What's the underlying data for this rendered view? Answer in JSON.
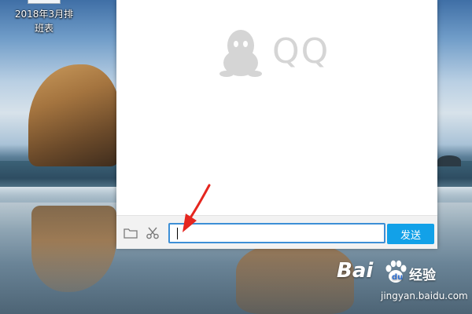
{
  "desktop": {
    "file_icon_label": "2018年3月排班表"
  },
  "qq_window": {
    "logo_text": "QQ",
    "toolbar": {
      "folder_icon": "folder-icon",
      "scissors_icon": "scissors-icon",
      "message_input_value": "",
      "send_label": "发送"
    }
  },
  "watermark": {
    "brand": "Bai",
    "brand_cn": "经验",
    "url": "jingyan.baidu.com"
  },
  "colors": {
    "send_button": "#12a1e8",
    "input_border": "#3d8fd6",
    "arrow": "#e5261f"
  }
}
